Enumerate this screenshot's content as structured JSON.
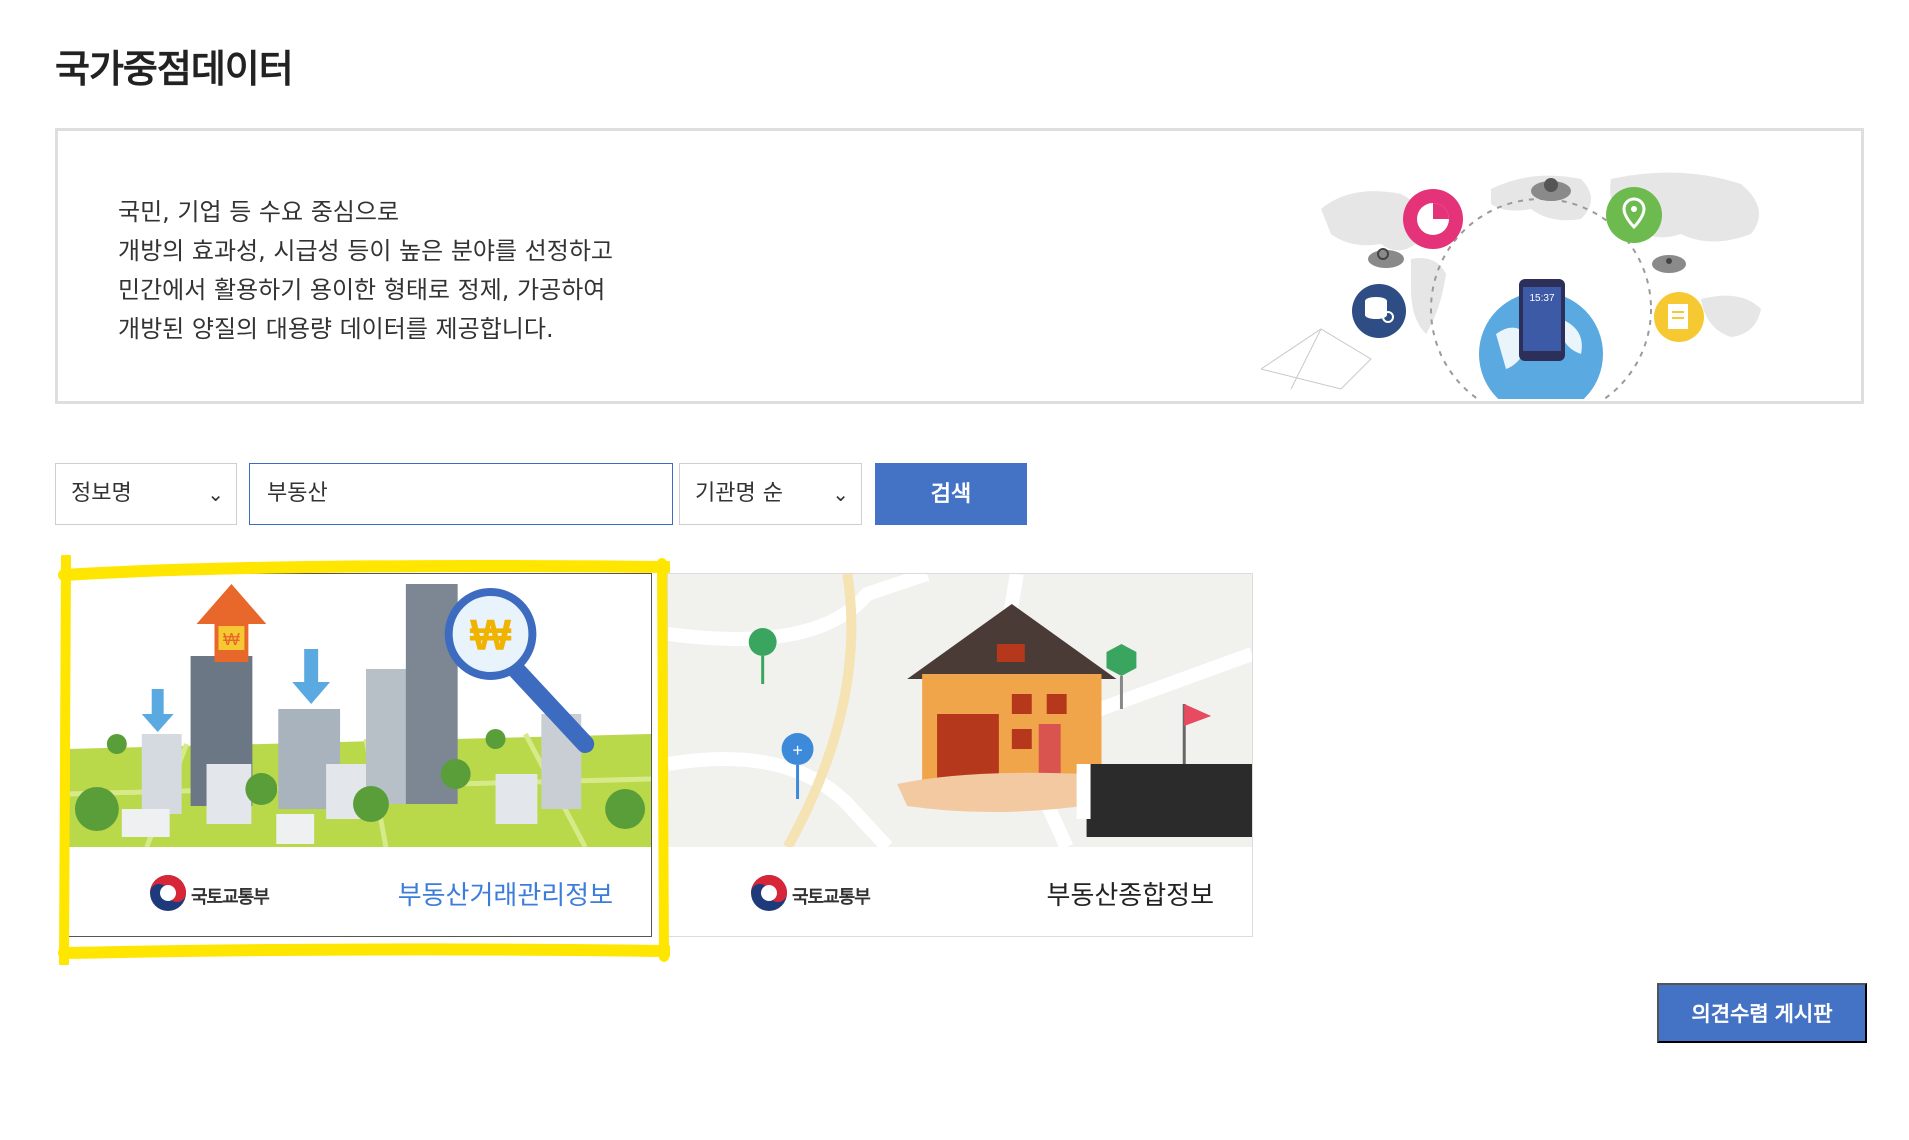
{
  "page": {
    "title": "국가중점데이터"
  },
  "intro": {
    "lines": [
      "국민, 기업 등 수요 중심으로",
      "개방의 효과성, 시급성 등이 높은 분야를 선정하고",
      "민간에서 활용하기 용이한 형태로 정제, 가공하여",
      "개방된 양질의 대용량 데이터를 제공합니다."
    ],
    "phone_time": "15:37",
    "illustration_icons": [
      "pie-chart-icon",
      "location-pin-icon",
      "database-search-icon",
      "document-icon",
      "gear-cloud-icon",
      "search-cloud-icon",
      "smartphone-icon",
      "globe-icon"
    ]
  },
  "filters": {
    "field_select": "정보명",
    "search_value": "부동산",
    "sort_select": "기관명 순",
    "search_button": "검색"
  },
  "cards": [
    {
      "agency": "국토교통부",
      "title": "부동산거래관리정보",
      "illustration_icons": [
        "won-arrow-icon",
        "down-arrow-icon",
        "magnifier-won-icon",
        "buildings-icon",
        "trees-icon"
      ]
    },
    {
      "agency": "국토교통부",
      "title": "부동산종합정보",
      "illustration_icons": [
        "house-icon",
        "map-pin-icon",
        "hand-icon",
        "flag-icon"
      ]
    }
  ],
  "board_button": "의견수렴 게시판",
  "colors": {
    "primary": "#4472c4",
    "card_title_active": "#3c7dd9",
    "highlight": "#ffe600"
  }
}
